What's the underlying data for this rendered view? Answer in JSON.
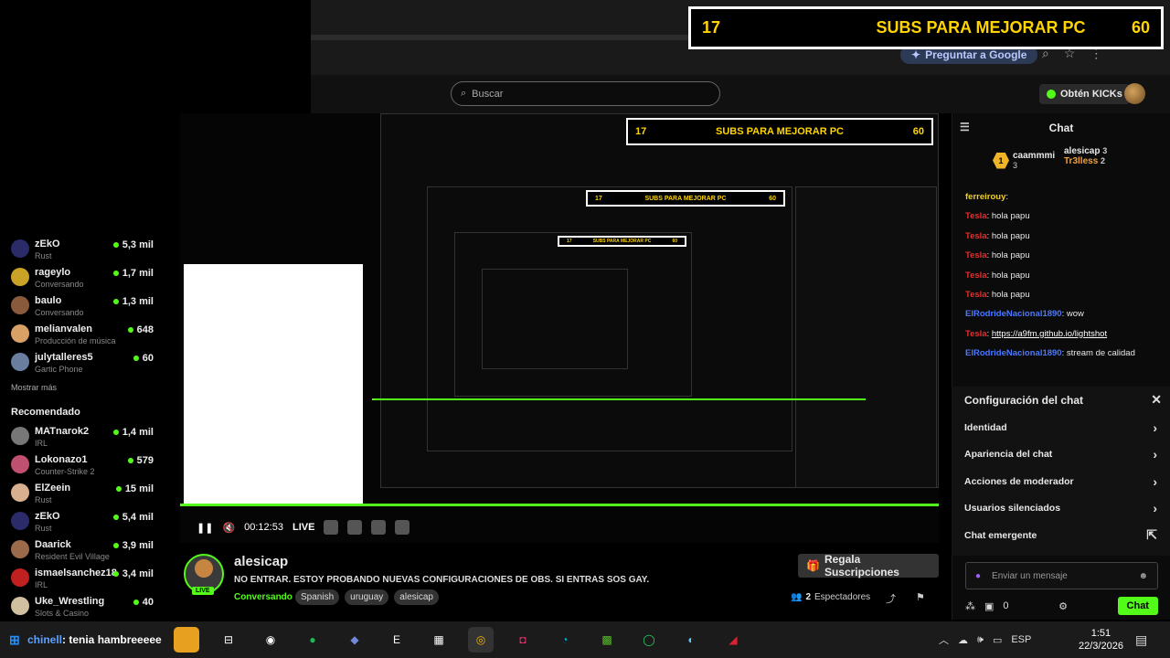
{
  "banner": {
    "left": "17",
    "text": "SUBS PARA MEJORAR PC",
    "right": "60"
  },
  "top": {
    "google": "Preguntar a Google"
  },
  "header": {
    "search_placeholder": "Buscar",
    "kicks": "Obtén KICKs"
  },
  "sidebar": {
    "following": [
      {
        "name": "zEkO",
        "category": "Rust",
        "viewers": "5,3 mil",
        "color": "#2b2b6a"
      },
      {
        "name": "rageylo",
        "category": "Conversando",
        "viewers": "1,7 mil",
        "color": "#c9a227"
      },
      {
        "name": "baulo",
        "category": "Conversando",
        "viewers": "1,3 mil",
        "color": "#8a5a3c"
      },
      {
        "name": "melianvalen",
        "category": "Producción de música",
        "viewers": "648",
        "color": "#d9a066"
      },
      {
        "name": "julytalleres5",
        "category": "Gartic Phone",
        "viewers": "60",
        "color": "#6a7fa0"
      }
    ],
    "show_more": "Mostrar más",
    "recommended_title": "Recomendado",
    "recommended": [
      {
        "name": "MATnarok2",
        "category": "IRL",
        "viewers": "1,4 mil",
        "color": "#777"
      },
      {
        "name": "Lokonazo1",
        "category": "Counter-Strike 2",
        "viewers": "579",
        "color": "#c05070"
      },
      {
        "name": "ElZeein",
        "category": "Rust",
        "viewers": "15 mil",
        "color": "#d8b090"
      },
      {
        "name": "zEkO",
        "category": "Rust",
        "viewers": "5,4 mil",
        "color": "#2b2b6a"
      },
      {
        "name": "Daarick",
        "category": "Resident Evil Village",
        "viewers": "3,9 mil",
        "color": "#9a6a4a"
      },
      {
        "name": "ismaelsanchez18",
        "category": "IRL",
        "viewers": "3,4 mil",
        "color": "#c02020"
      },
      {
        "name": "Uke_Wrestling",
        "category": "Slots & Casino",
        "viewers": "40",
        "color": "#d0c0a0"
      }
    ]
  },
  "player": {
    "time": "00:12:53",
    "live": "LIVE"
  },
  "streamer": {
    "name": "alesicap",
    "live_badge": "LIVE",
    "title": "NO ENTRAR. ESTOY PROBANDO NUEVAS CONFIGURACIONES DE OBS. SI ENTRAS SOS GAY.",
    "category": "Conversando",
    "tags": [
      "Spanish",
      "uruguay",
      "alesicap"
    ],
    "gift": "Regala Suscripciones",
    "viewers_count": "2",
    "viewers_label": "Espectadores"
  },
  "chat": {
    "title": "Chat",
    "donors": [
      {
        "rank": "1",
        "name": "caammmi",
        "count": "3"
      },
      {
        "name": "alesicap",
        "count": "3"
      },
      {
        "name": "Tr3lless",
        "count": "2"
      }
    ],
    "messages": [
      {
        "user": "ferreirouy",
        "text": "",
        "color": "#f0d020"
      },
      {
        "user": "Tesla",
        "text": "hola papu",
        "color": "#e03030"
      },
      {
        "user": "Tesla",
        "text": "hola papu",
        "color": "#e03030"
      },
      {
        "user": "Tesla",
        "text": "hola papu",
        "color": "#e03030"
      },
      {
        "user": "Tesla",
        "text": "hola papu",
        "color": "#e03030"
      },
      {
        "user": "Tesla",
        "text": "hola papu",
        "color": "#e03030"
      },
      {
        "user": "ElRodrideNacional1890",
        "text": "wow",
        "color": "#4a78ff"
      },
      {
        "user": "Tesla",
        "text": "https://a9fm.github.io/lightshot",
        "color": "#e03030",
        "link": true
      },
      {
        "user": "ElRodrideNacional1890",
        "text": "stream de calidad",
        "color": "#4a78ff"
      }
    ],
    "settings_title": "Configuración del chat",
    "settings_items": [
      "Identidad",
      "Apariencia del chat",
      "Acciones de moderador",
      "Usuarios silenciados",
      "Chat emergente"
    ],
    "input_placeholder": "Enviar un mensaje",
    "kick_count": "0",
    "send": "Chat"
  },
  "taskbar": {
    "overlay_user": "chinell",
    "overlay_text": ": tenia hambreeeee",
    "lang": "ESP",
    "time": "1:51",
    "date": "22/3/2026"
  }
}
